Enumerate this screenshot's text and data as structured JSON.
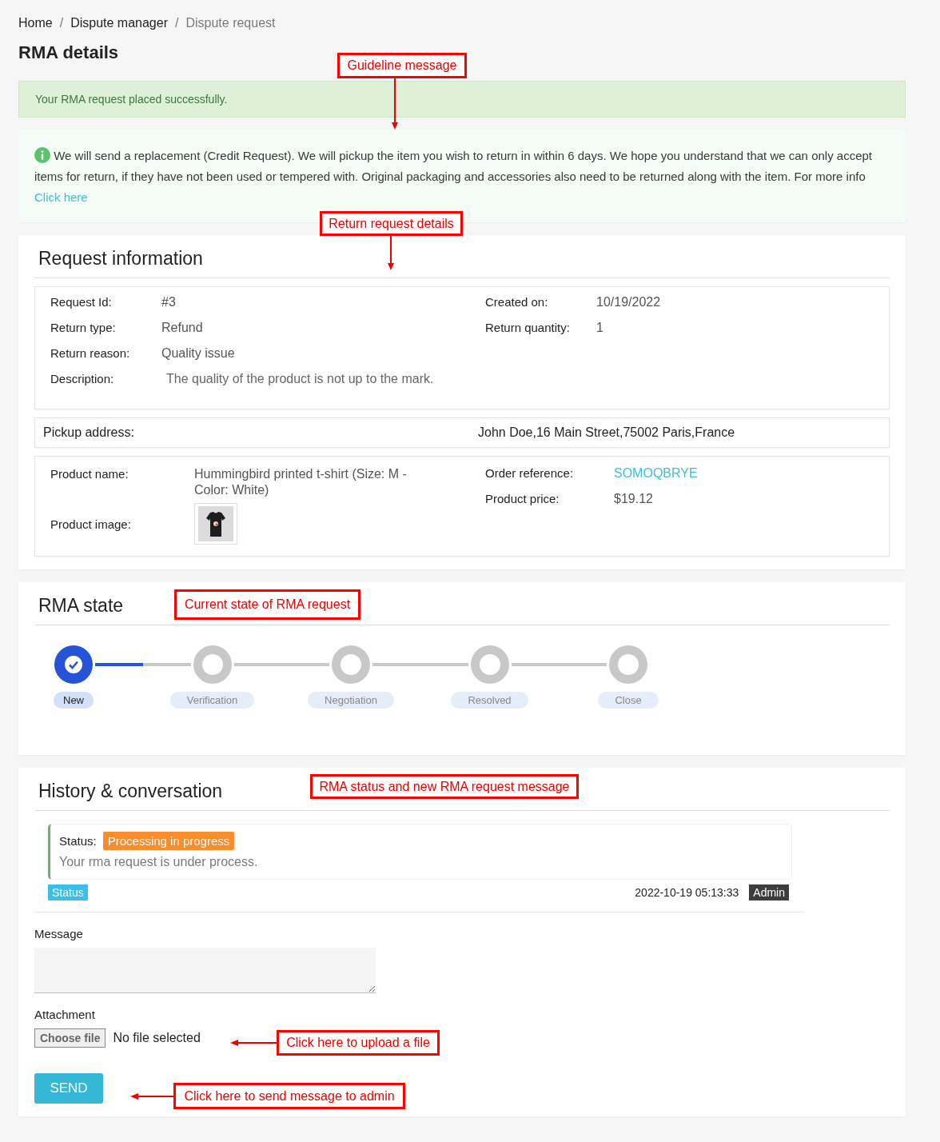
{
  "breadcrumb": [
    {
      "label": "Home",
      "current": false
    },
    {
      "separator": "/",
      "label": "Dispute manager",
      "current": false
    },
    {
      "separator": "/",
      "label": "Dispute request",
      "current": true
    }
  ],
  "title": "RMA details",
  "success_alert": "Your RMA request placed successfully.",
  "info": {
    "text": "We will send a replacement (Credit Request). We will pickup the item you wish to return in within 6 days. We hope you understand that we can only accept items for return, if they have not been used or tempered with. Original packaging and accessories also need to be returned along with the item. For more info",
    "link": "Click here"
  },
  "request_information": {
    "heading": "Request information",
    "left_fields": [
      {
        "label": "Request Id:",
        "value": "#3"
      },
      {
        "label": "Return type:",
        "value": "Refund"
      },
      {
        "label": "Return reason:",
        "value": "Quality issue"
      },
      {
        "label": "Description:",
        "value": "The quality of the product is not up to the mark.",
        "kind": "note"
      }
    ],
    "right_fields": [
      {
        "label": "Created on:",
        "value": "10/19/2022"
      },
      {
        "label": "Return quantity:",
        "value": "1"
      }
    ],
    "pickup": {
      "label": "Pickup address:",
      "value": "John Doe,16 Main Street,75002 Paris,France"
    },
    "product": {
      "name_label": "Product name:",
      "name": "Hummingbird printed t-shirt (Size: M - Color: White)",
      "image_label": "Product image:",
      "right_fields": [
        {
          "label": "Order reference:",
          "value": "SOMOQBRYE",
          "kind": "link"
        },
        {
          "label": "Product price:",
          "value": "$19.12",
          "kind": "text"
        }
      ]
    }
  },
  "rma_state": {
    "heading": "RMA state",
    "steps": [
      {
        "label": "New",
        "done": true,
        "level": 0.5
      },
      {
        "label": "Verification",
        "done": false,
        "level": 0
      },
      {
        "label": "Negotiation",
        "done": false,
        "level": 0
      },
      {
        "label": "Resolved",
        "done": false,
        "level": 0
      },
      {
        "label": "Close",
        "done": false
      }
    ]
  },
  "history": {
    "heading": "History & conversation",
    "entries": [
      {
        "status_label": "Status:",
        "status": "Processing in progress",
        "message": "Your rma request is under process.",
        "type": "Status",
        "date": "2022-10-19 05:13:33",
        "author": "Admin"
      }
    ],
    "message_label": "Message",
    "attachment_label": "Attachment",
    "file_button": "Choose file",
    "file_status": "No file selected",
    "send": "SEND"
  },
  "callouts": [
    {
      "text": "Guideline message",
      "kind": "down"
    },
    {
      "text": "Return request details",
      "kind": "down"
    },
    {
      "text": "Current state of RMA request",
      "kind": "plain"
    },
    {
      "text": "RMA status and new RMA request message",
      "kind": "plain"
    },
    {
      "text": "Click here to upload a file",
      "kind": "left"
    },
    {
      "text": "Click here to send message to admin",
      "kind": "left"
    }
  ]
}
